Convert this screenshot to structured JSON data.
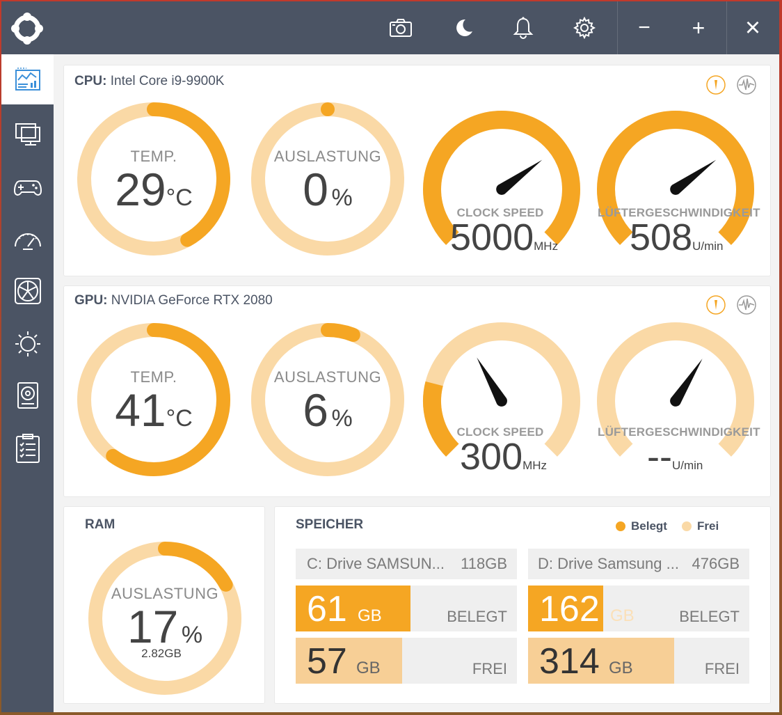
{
  "colors": {
    "accent": "#f5a623",
    "accent_light": "#fad9a6",
    "titlebar": "#4b5464",
    "needle": "#111111"
  },
  "toolbar": {
    "icons": [
      "camera-icon",
      "moon-icon",
      "bell-icon",
      "gear-icon"
    ],
    "minimize": "−",
    "maximize": "+",
    "close": "×"
  },
  "sidebar": {
    "items": [
      {
        "icon": "dashboard-icon",
        "active": true
      },
      {
        "icon": "monitor-icon",
        "active": false
      },
      {
        "icon": "gamepad-icon",
        "active": false
      },
      {
        "icon": "speedometer-icon",
        "active": false
      },
      {
        "icon": "fan-icon",
        "active": false
      },
      {
        "icon": "brightness-icon",
        "active": false
      },
      {
        "icon": "hard-drive-icon",
        "active": false
      },
      {
        "icon": "checklist-icon",
        "active": false
      }
    ]
  },
  "cpu": {
    "prefix": "CPU:",
    "name": "Intel Core i9-9900K",
    "temp": {
      "label": "TEMP.",
      "value": "29",
      "unit": "°C",
      "fraction": 0.42
    },
    "load": {
      "label": "AUSLASTUNG",
      "value": "0",
      "unit": "%",
      "fraction": 0.0
    },
    "clock": {
      "label": "CLOCK SPEED",
      "value": "5000",
      "unit": "MHz",
      "fraction": 1.0,
      "needle": 0.7
    },
    "fan": {
      "label": "LÜFTERGESCHWINDIGKEIT",
      "value": "508",
      "unit": "U/min",
      "fraction": 1.0,
      "needle": 0.7
    }
  },
  "gpu": {
    "prefix": "GPU:",
    "name": "NVIDIA GeForce RTX 2080",
    "temp": {
      "label": "TEMP.",
      "value": "41",
      "unit": "°C",
      "fraction": 0.6
    },
    "load": {
      "label": "AUSLASTUNG",
      "value": "6",
      "unit": "%",
      "fraction": 0.06
    },
    "clock": {
      "label": "CLOCK SPEED",
      "value": "300",
      "unit": "MHz",
      "fraction": 0.22,
      "needle": 0.39
    },
    "fan": {
      "label": "LÜFTERGESCHWINDIGKEIT",
      "value": "--",
      "unit": "U/min",
      "fraction": 0.0,
      "needle": 0.62
    }
  },
  "ram": {
    "title": "RAM",
    "label": "AUSLASTUNG",
    "value": "17",
    "unit": "%",
    "used": "2.82GB",
    "fraction": 0.17
  },
  "storage": {
    "title": "SPEICHER",
    "legend_used": "Belegt",
    "legend_free": "Frei",
    "drives": [
      {
        "name": "C: Drive SAMSUN...",
        "total": "118GB",
        "used": "61",
        "free": "57",
        "unit": "GB",
        "used_fraction": 0.52,
        "free_fraction": 0.48,
        "used_tag": "BELEGT",
        "free_tag": "FREI"
      },
      {
        "name": "D: Drive Samsung ...",
        "total": "476GB",
        "used": "162",
        "free": "314",
        "unit": "GB",
        "used_fraction": 0.34,
        "free_fraction": 0.66,
        "used_tag": "BELEGT",
        "free_tag": "FREI"
      }
    ]
  }
}
